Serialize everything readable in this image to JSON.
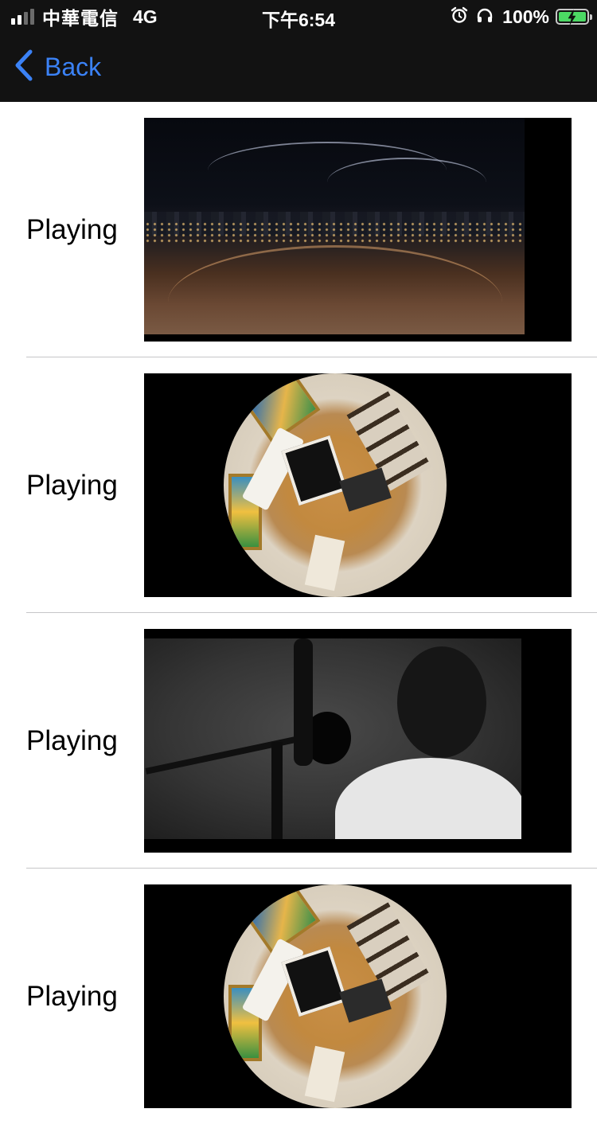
{
  "status_bar": {
    "carrier": "中華電信",
    "network": "4G",
    "time": "下午6:54",
    "battery_percent": "100%",
    "signal_bars_filled": 2,
    "signal_bars_total": 4,
    "icons": [
      "alarm-icon",
      "headphones-icon",
      "battery-charging-icon"
    ]
  },
  "nav": {
    "back_label": "Back",
    "accent_color": "#3b82f6"
  },
  "list": {
    "items": [
      {
        "label": "Playing",
        "thumbnail": "city-night-360-panorama"
      },
      {
        "label": "Playing",
        "thumbnail": "fisheye-room-360"
      },
      {
        "label": "Playing",
        "thumbnail": "studio-singer-bw"
      },
      {
        "label": "Playing",
        "thumbnail": "fisheye-room-360"
      }
    ]
  }
}
